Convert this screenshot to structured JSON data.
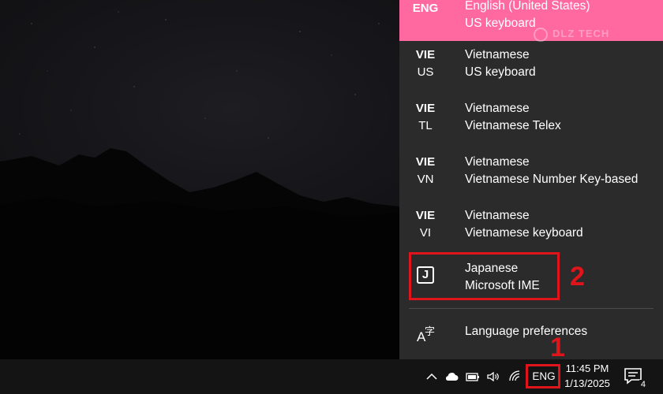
{
  "language_flyout": {
    "items": [
      {
        "code_line1": "ENG",
        "code_line2": "",
        "language": "English (United States)",
        "layout": "US keyboard",
        "selected": true
      },
      {
        "code_line1": "VIE",
        "code_line2": "US",
        "language": "Vietnamese",
        "layout": "US keyboard",
        "selected": false
      },
      {
        "code_line1": "VIE",
        "code_line2": "TL",
        "language": "Vietnamese",
        "layout": "Vietnamese Telex",
        "selected": false
      },
      {
        "code_line1": "VIE",
        "code_line2": "VN",
        "language": "Vietnamese",
        "layout": "Vietnamese Number Key-based",
        "selected": false
      },
      {
        "code_line1": "VIE",
        "code_line2": "VI",
        "language": "Vietnamese",
        "layout": "Vietnamese keyboard",
        "selected": false
      },
      {
        "code_line1": "",
        "code_line2": "",
        "icon": "japanese-ime-icon",
        "language": "Japanese",
        "layout": "Microsoft IME",
        "selected": false
      }
    ],
    "preferences_label": "Language preferences",
    "preferences_icon": "language-preferences-icon",
    "accent_color": "#ff69a0",
    "background_color": "#2b2b2b"
  },
  "watermark": {
    "text": "DLZ TECH"
  },
  "taskbar": {
    "tray_icons": [
      "chevron-up-icon",
      "cloud-icon",
      "battery-icon",
      "speaker-icon",
      "wifi-icon"
    ],
    "language_indicator": "ENG",
    "clock": {
      "time": "11:45 PM",
      "date": "1/13/2025"
    },
    "notifications": {
      "icon": "notification-icon",
      "count": "4"
    }
  },
  "annotations": {
    "step_1": "1",
    "step_2": "2",
    "color": "#e0141b"
  },
  "ime_glyph": "J",
  "pref_glyph_a": "A",
  "pref_glyph_char": "字"
}
